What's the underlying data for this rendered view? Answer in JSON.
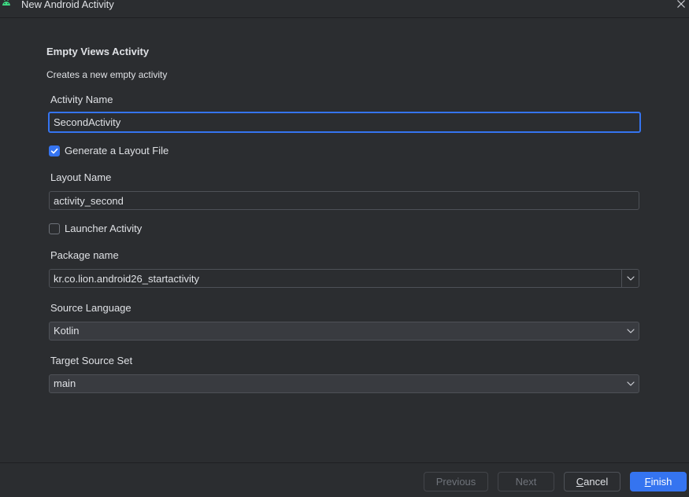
{
  "window": {
    "title": "New Android Activity",
    "app_icon": "android-icon",
    "close_icon": "close-icon"
  },
  "template": {
    "name": "Empty Views Activity",
    "description": "Creates a new empty activity"
  },
  "form": {
    "activity_name": {
      "label": "Activity Name",
      "value": "SecondActivity",
      "focused": true
    },
    "generate_layout_file": {
      "label": "Generate a Layout File",
      "checked": true
    },
    "layout_name": {
      "label": "Layout Name",
      "value": "activity_second"
    },
    "launcher_activity": {
      "label": "Launcher Activity",
      "checked": false
    },
    "package_name": {
      "label": "Package name",
      "value": "kr.co.lion.android26_startactivity",
      "dropdown_icon": "chevron-down-icon"
    },
    "source_language": {
      "label": "Source Language",
      "value": "Kotlin",
      "dropdown_icon": "chevron-down-icon"
    },
    "target_source_set": {
      "label": "Target Source Set",
      "value": "main",
      "dropdown_icon": "chevron-down-icon"
    }
  },
  "buttons": {
    "previous": {
      "label": "Previous",
      "enabled": false
    },
    "next": {
      "label": "Next",
      "enabled": false
    },
    "cancel": {
      "label": "Cancel",
      "enabled": true
    },
    "finish": {
      "label": "Finish",
      "enabled": true,
      "primary": true
    }
  },
  "colors": {
    "accent": "#3574f0",
    "background": "#2b2d30",
    "android_icon": "#3ddc84"
  }
}
